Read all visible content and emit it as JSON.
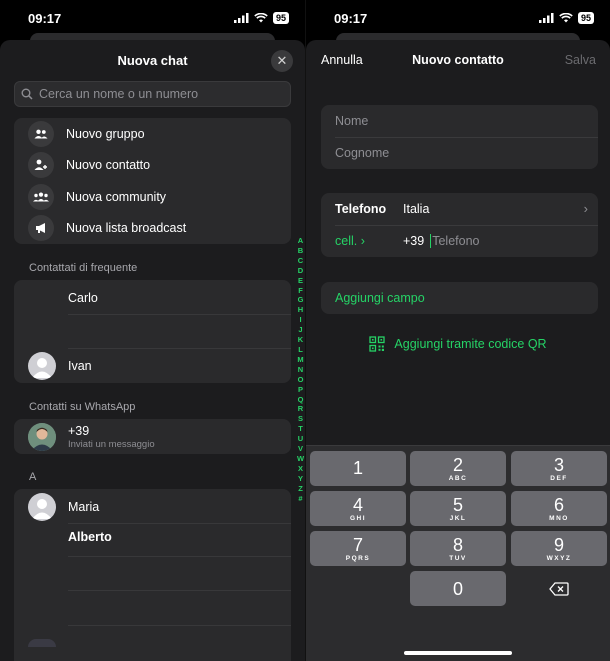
{
  "status": {
    "time": "09:17",
    "battery": "95"
  },
  "left": {
    "title": "Nuova chat",
    "search_placeholder": "Cerca un nome o un numero",
    "actions": [
      {
        "label": "Nuovo gruppo",
        "icon": "group-icon"
      },
      {
        "label": "Nuovo contatto",
        "icon": "add-contact-icon"
      },
      {
        "label": "Nuova community",
        "icon": "community-icon"
      },
      {
        "label": "Nuova lista broadcast",
        "icon": "megaphone-icon"
      }
    ],
    "frequent_label": "Contattati di frequente",
    "frequent": [
      "Carlo",
      "Ivan"
    ],
    "whatsapp_label": "Contatti su WhatsApp",
    "whatsapp_contact": {
      "number": "+39",
      "subtitle": "Inviati un messaggio"
    },
    "section_a": "A",
    "a_contacts": [
      "Maria",
      "Alberto"
    ],
    "index_letters": [
      "A",
      "B",
      "C",
      "D",
      "E",
      "F",
      "G",
      "H",
      "I",
      "J",
      "K",
      "L",
      "M",
      "N",
      "O",
      "P",
      "Q",
      "R",
      "S",
      "T",
      "U",
      "V",
      "W",
      "X",
      "Y",
      "Z",
      "#"
    ]
  },
  "right": {
    "cancel": "Annulla",
    "title": "Nuovo contatto",
    "save": "Salva",
    "name_placeholder": "Nome",
    "surname_placeholder": "Cognome",
    "phone_label": "Telefono",
    "country": "Italia",
    "phone_type": "cell. ›",
    "prefix": "+39",
    "phone_placeholder": "Telefono",
    "add_field": "Aggiungi campo",
    "qr_link": "Aggiungi tramite codice QR"
  },
  "keypad": [
    {
      "num": "1",
      "letters": ""
    },
    {
      "num": "2",
      "letters": "ABC"
    },
    {
      "num": "3",
      "letters": "DEF"
    },
    {
      "num": "4",
      "letters": "GHI"
    },
    {
      "num": "5",
      "letters": "JKL"
    },
    {
      "num": "6",
      "letters": "MNO"
    },
    {
      "num": "7",
      "letters": "PQRS"
    },
    {
      "num": "8",
      "letters": "TUV"
    },
    {
      "num": "9",
      "letters": "WXYZ"
    },
    {
      "num": "0",
      "letters": ""
    }
  ],
  "colors": {
    "accent": "#25d366",
    "sheet": "#1c1c1e",
    "cell": "#2a2a2c",
    "key": "#69696e"
  }
}
